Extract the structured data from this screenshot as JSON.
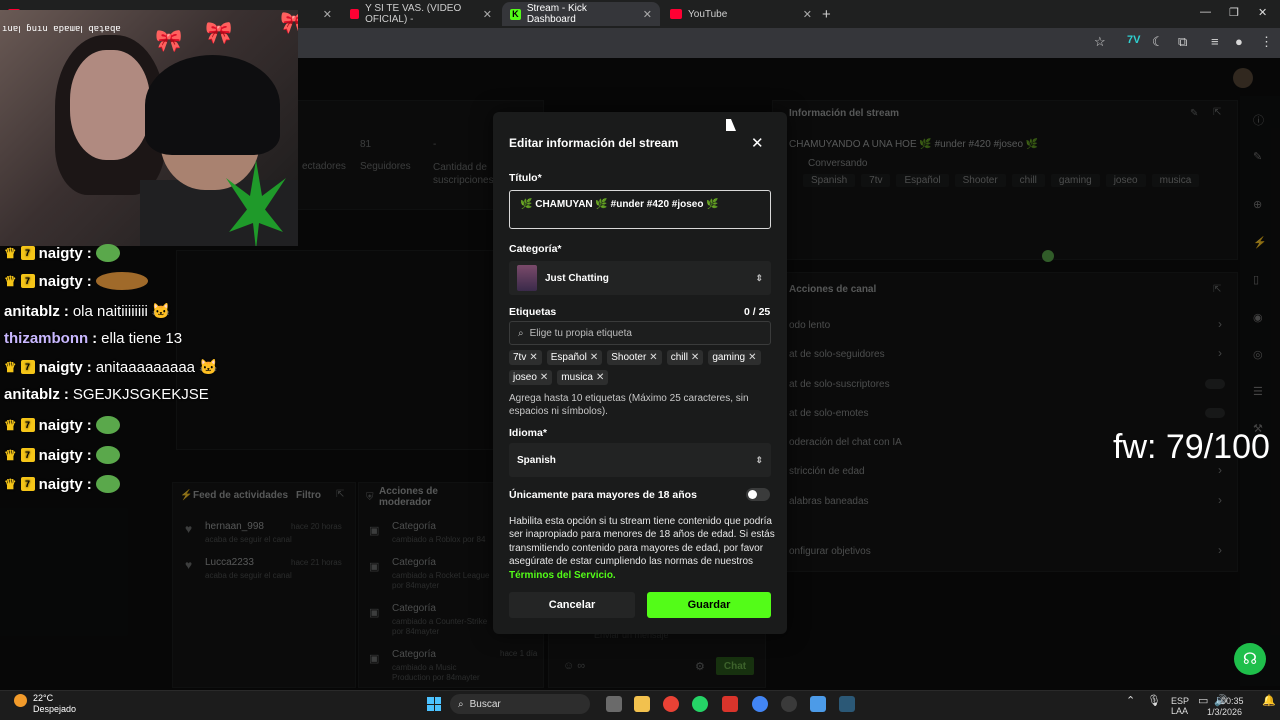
{
  "browser": {
    "tabs": [
      {
        "label": "",
        "kind": "yt"
      },
      {
        "label": "Y SI TE VAS. (VIDEO OFICIAL) -",
        "kind": "yt"
      },
      {
        "label": "Stream - Kick Dashboard",
        "kind": "kick"
      },
      {
        "label": "YouTube",
        "kind": "yt"
      }
    ]
  },
  "webcam": {
    "mirror_text": "ıuɐꞁ ɓuıu ɐpɐɯɐꞁ qɐʇɐqɐ"
  },
  "chat": [
    {
      "user": "naigty",
      "msg": "",
      "emote": true
    },
    {
      "user": "naigty",
      "msg": "",
      "emote": true
    },
    {
      "user": "anitablz",
      "msg": "ola naitiiiiiiii",
      "emote": false
    },
    {
      "user": "thizambonn",
      "msg": "ella tiene 13",
      "emote": false
    },
    {
      "user": "naigty",
      "msg": "anitaaaaaaaaa",
      "emote": false
    },
    {
      "user": "anitablz",
      "msg": "SGEJKJSGKEKJSE",
      "emote": false
    },
    {
      "user": "naigty",
      "msg": "",
      "emote": true
    },
    {
      "user": "naigty",
      "msg": "",
      "emote": true
    },
    {
      "user": "naigty",
      "msg": "",
      "emote": true
    }
  ],
  "overlay": {
    "fw": "fw: 79/100"
  },
  "background": {
    "stats": [
      {
        "value": "81",
        "label": "Seguidores"
      },
      {
        "value": "-",
        "label": "Cantidad de suscripciones"
      }
    ],
    "stat_prefix": "ectadores",
    "stream_info": {
      "title": "Información del stream",
      "name": "CHAMUYANDO A UNA HOE 🌿 #under #420 #joseo 🌿",
      "category": "Conversando",
      "tags": [
        "Spanish",
        "7tv",
        "Español",
        "Shooter",
        "chill",
        "gaming",
        "joseo",
        "musica"
      ]
    },
    "actions": {
      "title": "Acciones de canal",
      "items": [
        {
          "label": "odo lento"
        },
        {
          "label": "at de solo-seguidores"
        },
        {
          "label": "at de solo-suscriptores"
        },
        {
          "label": "at de solo-emotes"
        },
        {
          "label": "oderación del chat con IA"
        },
        {
          "label": "stricción de edad"
        },
        {
          "label": "alabras baneadas"
        },
        {
          "label": "onfigurar objetivos"
        }
      ]
    },
    "feed": {
      "title": "Feed de actividades",
      "filter": "Filtro",
      "items": [
        {
          "name": "hernaan_998",
          "sub": "acaba de seguir el canal",
          "time": "hace 20 horas"
        },
        {
          "name": "Lucca2233",
          "sub": "acaba de seguir el canal",
          "time": "hace 21 horas"
        }
      ]
    },
    "mod": {
      "title": "Acciones de moderador",
      "items": [
        {
          "label": "Categoría",
          "sub": "cambiado a Roblox por 84"
        },
        {
          "label": "Categoría",
          "sub": "cambiado a Rocket League por 84mayter"
        },
        {
          "label": "Categoría",
          "sub": "cambiado a Counter-Strike por 84mayter"
        },
        {
          "label": "Categoría",
          "sub": "cambiado a Music Production por 84mayter",
          "time": "hace 1 día"
        }
      ]
    },
    "chat_send": "Chat",
    "chat_placeholder": "Enviar un mensaje"
  },
  "modal": {
    "title": "Editar información del stream",
    "titulo_label": "Título*",
    "titulo_value": "🌿 CHAMUYAN 🌿 #under #420 #joseo 🌿",
    "categoria_label": "Categoría*",
    "categoria_value": "Just Chatting",
    "etiquetas_label": "Etiquetas",
    "etiquetas_count": "0 / 25",
    "etiquetas_placeholder": "Elige tu propia etiqueta",
    "tags": [
      "7tv",
      "Español",
      "Shooter",
      "chill",
      "gaming",
      "joseo",
      "musica"
    ],
    "tags_hint": "Agrega hasta 10 etiquetas (Máximo 25 caracteres, sin espacios ni símbolos).",
    "idioma_label": "Idioma*",
    "idioma_value": "Spanish",
    "adult_label": "Únicamente para mayores de 18 años",
    "adult_on": false,
    "adult_text": "Habilita esta opción si tu stream tiene contenido que podría ser inapropiado para menores de 18 años de edad. Si estás transmitiendo contenido para mayores de edad, por favor asegúrate de estar cumpliendo las normas de nuestros",
    "adult_link": "Términos del Servicio.",
    "cancel": "Cancelar",
    "save": "Guardar"
  },
  "taskbar": {
    "temp": "22°C",
    "weather": "Despejado",
    "search": "Buscar",
    "lang1": "ESP",
    "lang2": "LAA",
    "time": "00:35",
    "date": "1/3/2026"
  },
  "colors": {
    "kick_green": "#53fc18",
    "bg": "#0d0e0e",
    "modal": "#1a1b1b"
  }
}
